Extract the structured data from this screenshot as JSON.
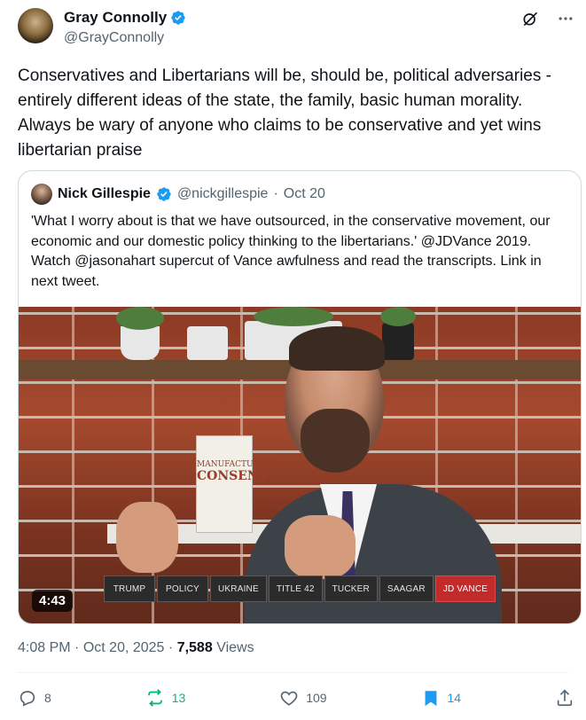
{
  "author": {
    "name": "Gray Connolly",
    "handle": "@GrayConnolly",
    "verified": true
  },
  "tweet": {
    "text": "Conservatives and Libertarians will be, should be, political adversaries - entirely different ideas of the state, the family, basic human morality. Always be wary of anyone who claims to be conservative and yet wins libertarian praise"
  },
  "quote": {
    "name": "Nick Gillespie",
    "handle": "@nickgillespie",
    "separator": "·",
    "date": "Oct 20",
    "text": "'What I worry about is that we have outsourced, in the conservative movement, our economic and our domestic policy thinking to the libertarians.' @JDVance 2019. Watch @jasonahart supercut of Vance awfulness and read the transcripts. Link in next tweet.",
    "video": {
      "duration": "4:43",
      "book_line1": "MANUFACTURING",
      "book_line2": "CONSENT",
      "chyron": [
        "TRUMP",
        "POLICY",
        "UKRAINE",
        "TITLE 42",
        "TUCKER",
        "SAAGAR",
        "JD VANCE"
      ],
      "chyron_active": "JD VANCE"
    }
  },
  "meta": {
    "time": "4:08 PM",
    "separator": "·",
    "date": "Oct 20, 2025",
    "views_count": "7,588",
    "views_label": "Views"
  },
  "actions": {
    "replies": "8",
    "reposts": "13",
    "likes": "109",
    "bookmarks": "14"
  },
  "colors": {
    "accent": "#1d9bf0",
    "repost": "#00ba7c",
    "muted": "#536471",
    "chyron_active": "#c32a2a"
  }
}
